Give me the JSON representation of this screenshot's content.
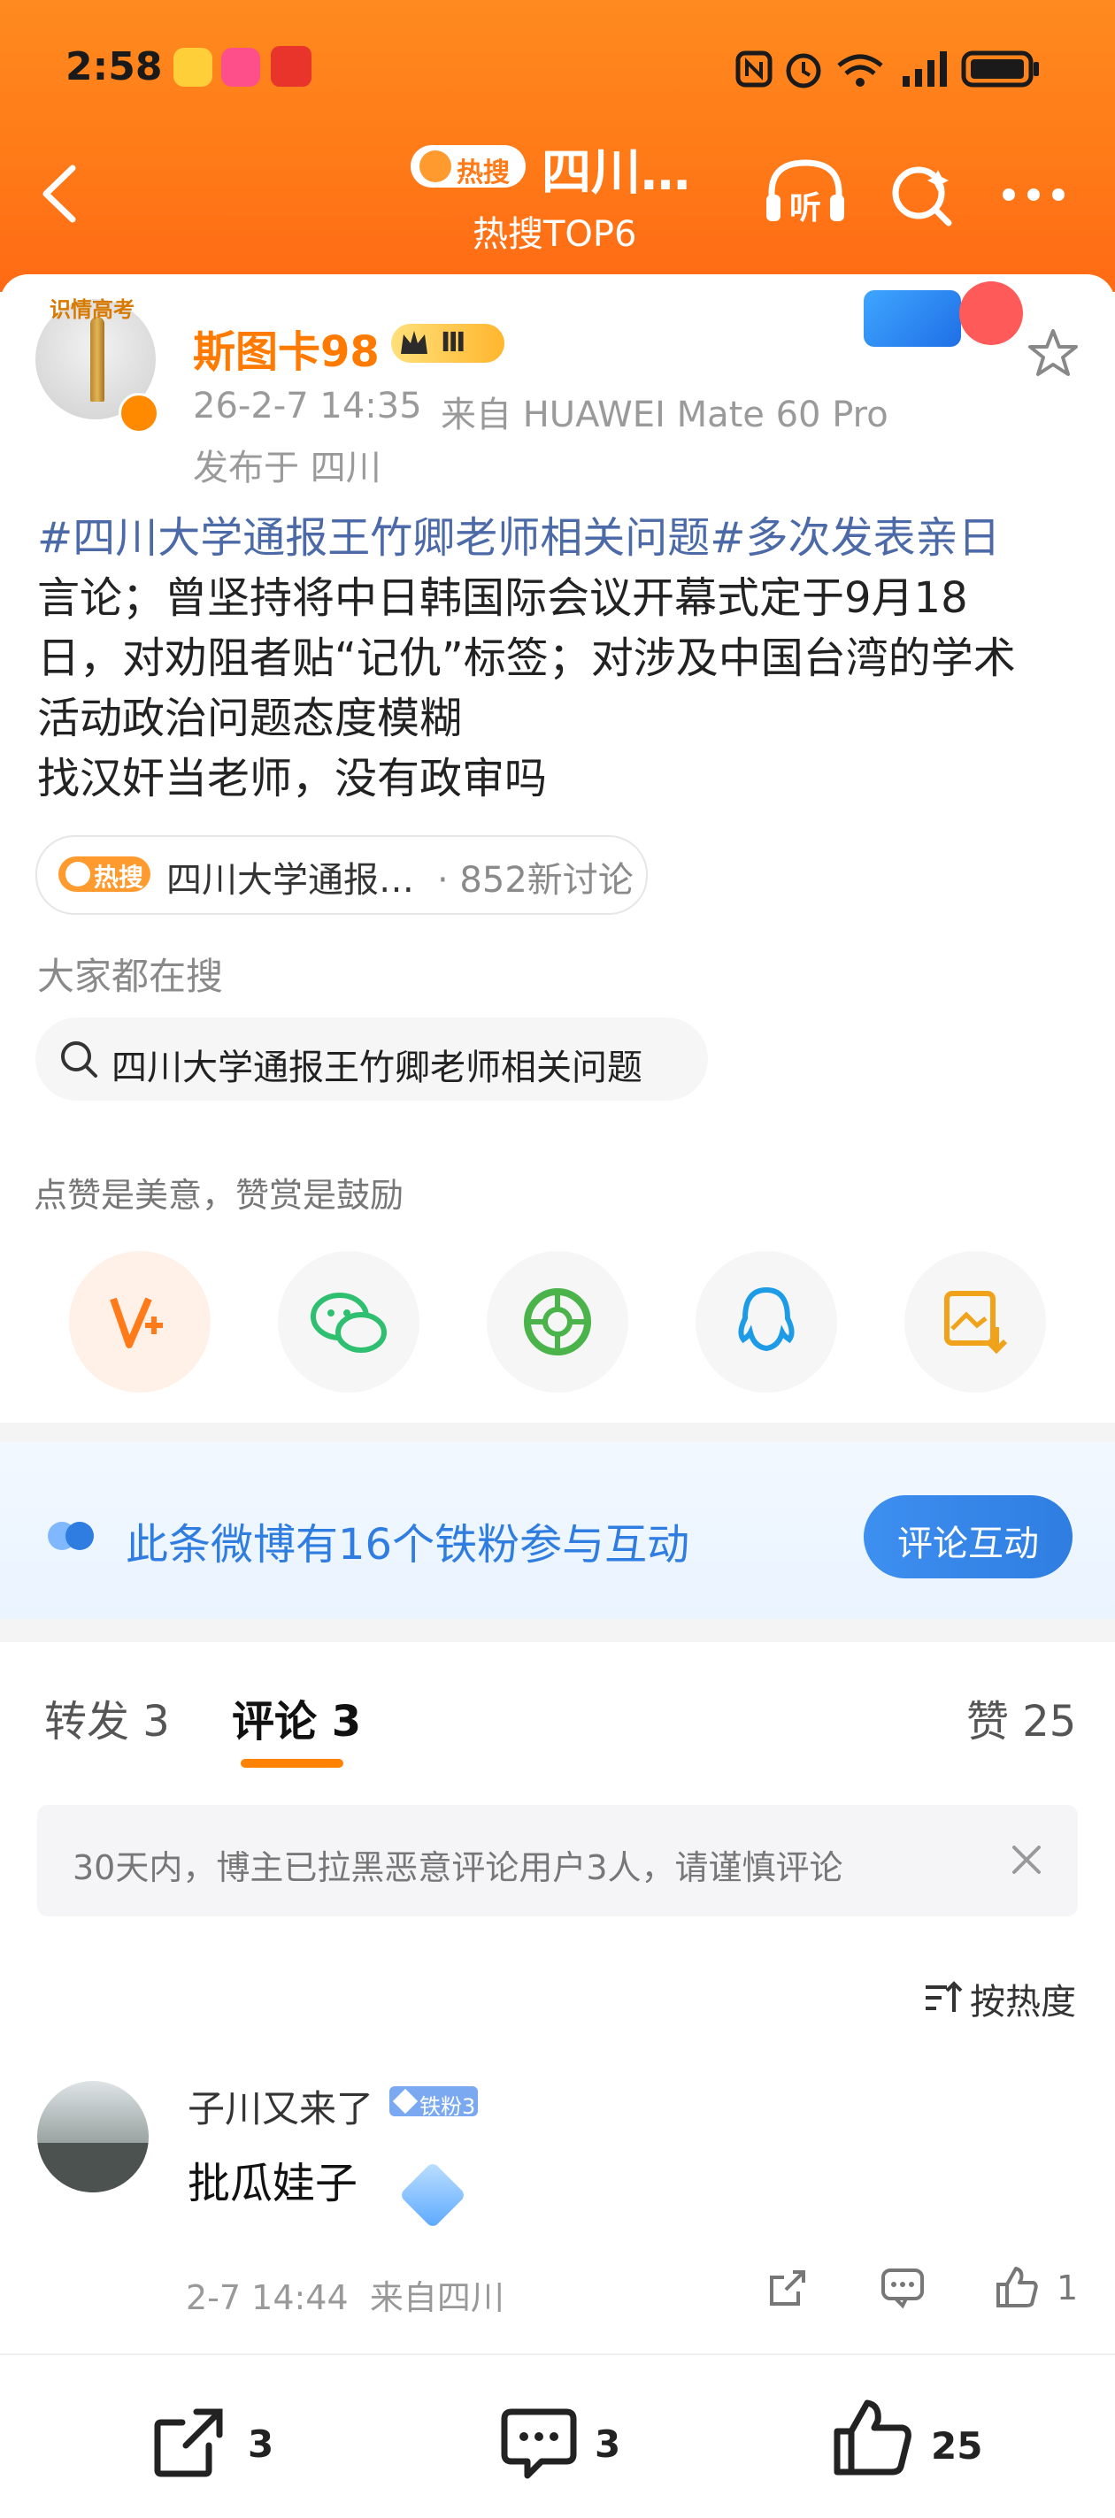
{
  "status_bar": {
    "time": "2:58"
  },
  "header": {
    "hot_badge": "热搜",
    "title": "四川…",
    "subtitle": "热搜TOP6",
    "listen_label": "听"
  },
  "post": {
    "author": "斯图卡98",
    "level_badge": "Ⅲ",
    "timestamp": "26-2-7 14:35",
    "device": "来自 HUAWEI Mate 60 Pro",
    "location": "发布于 四川",
    "text_line1": "#四川大学通报王竹卿老师相关问题#多次发表亲日",
    "text_line2": "言论；曾坚持将中日韩国际会议开幕式定于9月18",
    "text_line3": "日，对劝阻者贴“记仇”标签；对涉及中国台湾的学术",
    "text_line4": "活动政治问题态度模糊",
    "text_line5": "找汉奸当老师，没有政审吗",
    "topic_pill_badge": "热搜",
    "topic_pill_text": "四川大学通报…",
    "topic_pill_count": "· 852新讨论",
    "search_heading": "大家都在搜",
    "search_suggestion": "四川大学通报王竹卿老师相关问题",
    "share_hint": "点赞是美意，赞赏是鼓励",
    "avatar_badge_text": "识情高考"
  },
  "fan_banner": {
    "text": "此条微博有16个铁粉参与互动",
    "button": "评论互动"
  },
  "tabs": {
    "repost": "转发 3",
    "comments": "评论 3",
    "likes": "赞 25"
  },
  "notice": {
    "text": "30天内，博主已拉黑恶意评论用户3人，请谨慎评论"
  },
  "sort": {
    "label": "按热度"
  },
  "comment": {
    "user": "子川又来了",
    "fan_badge": "铁粉3",
    "text": "批瓜娃子",
    "meta": "2-7 14:44  来自四川",
    "like_count": "1"
  },
  "bottom": {
    "repost_count": "3",
    "comment_count": "3",
    "like_count": "25"
  },
  "colors": {
    "brand_orange": "#ff7a18",
    "link_blue": "#4c6aa8",
    "fan_blue": "#2f7de1"
  }
}
